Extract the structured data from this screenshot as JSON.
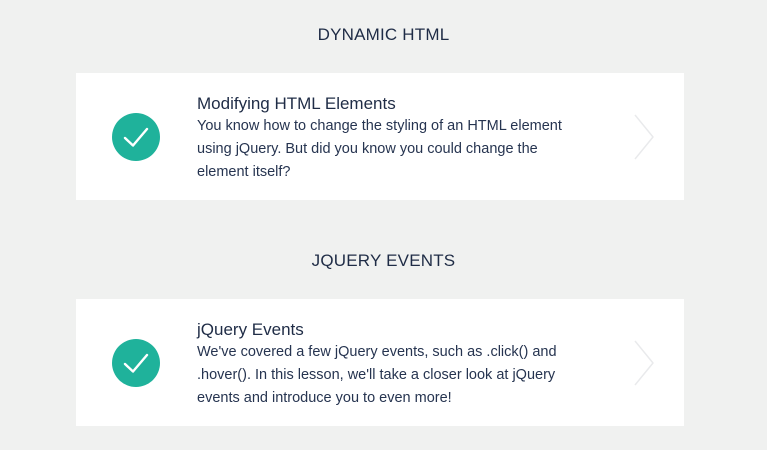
{
  "sections": [
    {
      "title": "DYNAMIC HTML",
      "lesson": {
        "title": "Modifying HTML Elements",
        "description_lines": [
          "You know how to change the styling of an HTML element",
          "using jQuery. But did you know you could change the",
          "element itself?"
        ],
        "completed": true
      }
    },
    {
      "title": "JQUERY EVENTS",
      "lesson": {
        "title": "jQuery Events",
        "description_lines": [
          "We've covered a few jQuery events, such as .click() and",
          ".hover(). In this lesson, we'll take a closer look at jQuery",
          "events and introduce you to even more!"
        ],
        "completed": true
      }
    }
  ],
  "icons": {
    "status": "checkmark-icon",
    "navigate": "chevron-right-icon"
  },
  "colors": {
    "background": "#f0f1f0",
    "card": "#ffffff",
    "check_circle": "#1fb29b",
    "text": "#1f2c46",
    "chevron": "#e9eaec"
  }
}
